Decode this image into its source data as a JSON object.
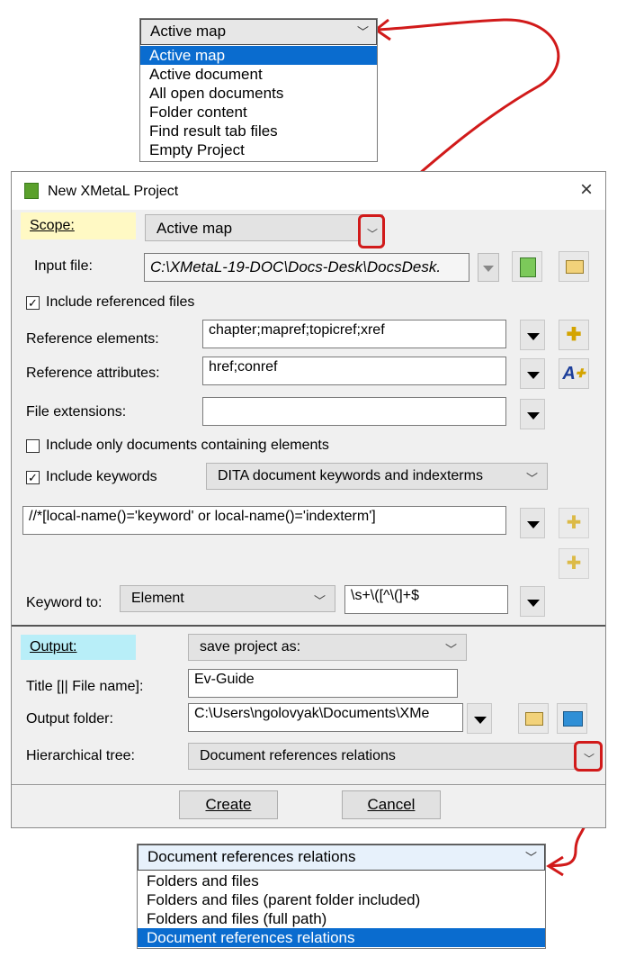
{
  "top_dropdown": {
    "selected": "Active map",
    "options": [
      "Active map",
      "Active document",
      "All open documents",
      "Folder content",
      "Find result tab files",
      "Empty Project"
    ],
    "highlighted_index": 0
  },
  "dialog": {
    "title": "New XMetaL Project",
    "close_glyph": "×",
    "scope": {
      "label": "Scope:",
      "value": "Active map"
    },
    "input_file": {
      "label": "Input file:",
      "value": "C:\\XMetaL-19-DOC\\Docs-Desk\\DocsDesk."
    },
    "include_referenced": {
      "label": "Include referenced files",
      "checked": true
    },
    "reference_elements": {
      "label": "Reference elements:",
      "value": "chapter;mapref;topicref;xref"
    },
    "reference_attributes": {
      "label": "Reference attributes:",
      "value": "href;conref"
    },
    "file_extensions": {
      "label": "File extensions:",
      "value": ""
    },
    "include_only_docs": {
      "label": "Include only documents containing elements",
      "checked": false
    },
    "include_keywords": {
      "label": "Include keywords",
      "checked": true,
      "combo": "DITA document keywords and indexterms"
    },
    "xpath": {
      "value": "//*[local-name()='keyword' or local-name()='indexterm']"
    },
    "keyword_to": {
      "label": "Keyword to:",
      "combo": "Element",
      "regex": "\\s+\\([^\\(]+$"
    },
    "output": {
      "label": "Output:",
      "value": "save project as:"
    },
    "title_field": {
      "label": "Title [|| File name]:",
      "value": "Ev-Guide"
    },
    "output_folder": {
      "label": "Output folder:",
      "value": "C:\\Users\\ngolovyak\\Documents\\XMe"
    },
    "hierarchical_tree": {
      "label": "Hierarchical tree:",
      "value": "Document references relations"
    },
    "create_label": "Create",
    "cancel_label": "Cancel"
  },
  "bottom_dropdown": {
    "selected": "Document references relations",
    "options": [
      "Folders and files",
      "Folders and files (parent folder included)",
      "Folders and files (full path)",
      "Document references relations"
    ],
    "highlighted_index": 3
  },
  "colors": {
    "highlight": "#0a6ccf",
    "annotation": "#d11a1a",
    "scope_label_bg": "#fff9c4",
    "output_label_bg": "#b8eef8"
  }
}
